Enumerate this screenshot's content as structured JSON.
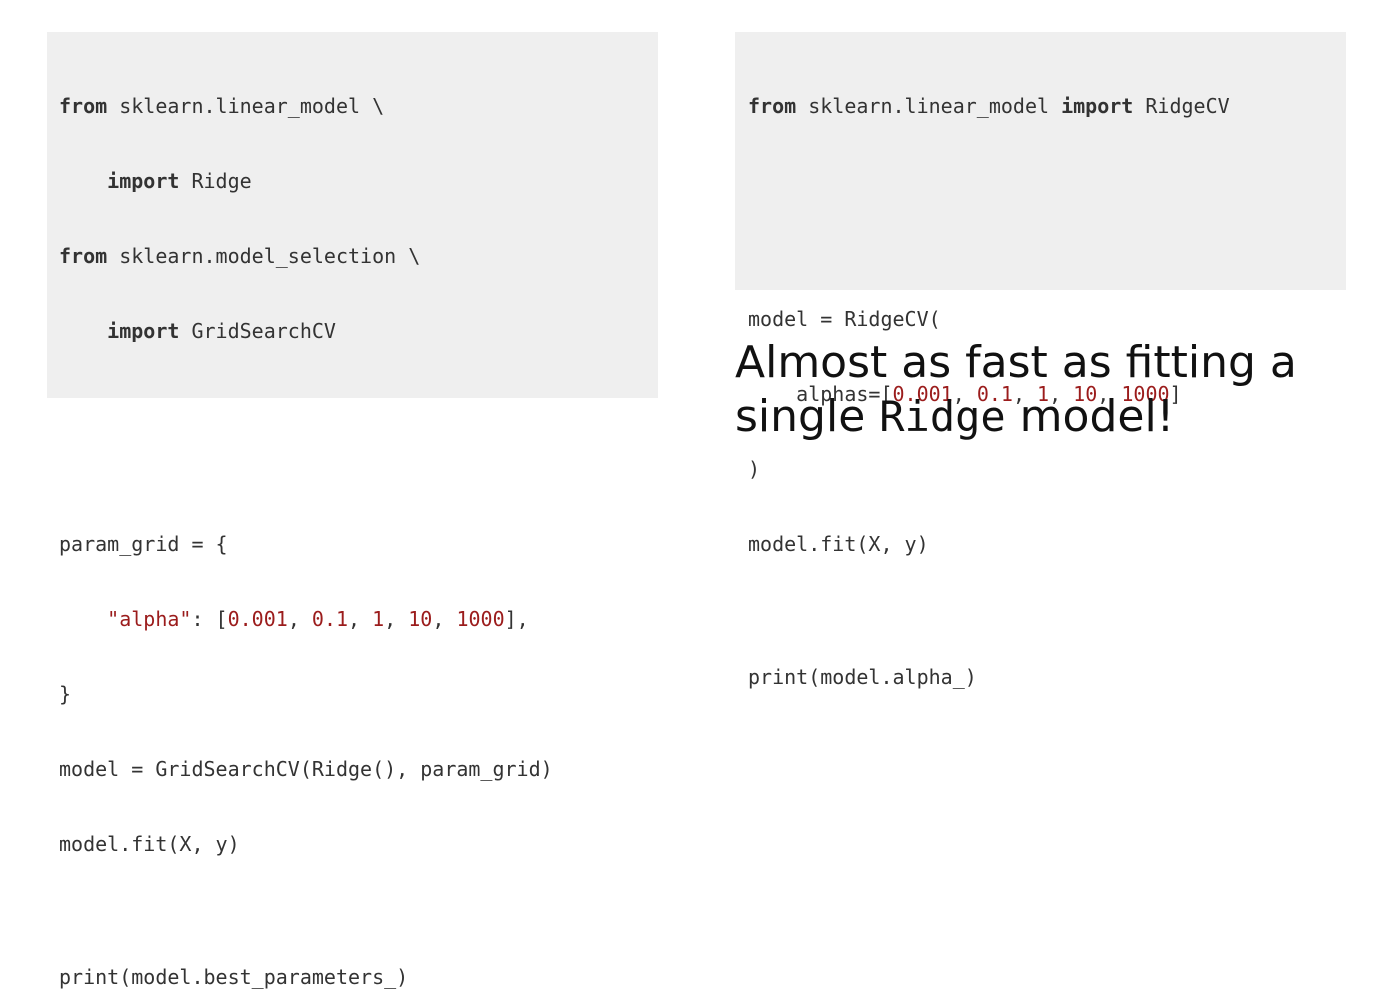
{
  "left_code": {
    "line1_kw": "from",
    "line1_rest": " sklearn.linear_model \\",
    "line2_indent": "    ",
    "line2_kw": "import",
    "line2_rest": " Ridge",
    "line3_kw": "from",
    "line3_rest": " sklearn.model_selection \\",
    "line4_indent": "    ",
    "line4_kw": "import",
    "line4_rest": " GridSearchCV",
    "line5": "param_grid = {",
    "line6_indent": "    ",
    "line6_str": "\"alpha\"",
    "line6_a": ": [",
    "line6_n1": "0.001",
    "line6_s1": ", ",
    "line6_n2": "0.1",
    "line6_s2": ", ",
    "line6_n3": "1",
    "line6_s3": ", ",
    "line6_n4": "10",
    "line6_s4": ", ",
    "line6_n5": "1000",
    "line6_end": "],",
    "line7": "}",
    "line8": "model = GridSearchCV(Ridge(), param_grid)",
    "line9": "model.fit(X, y)",
    "line10": "print(model.best_parameters_)"
  },
  "right_code": {
    "line1_kw": "from",
    "line1_mid": " sklearn.linear_model ",
    "line1_kw2": "import",
    "line1_rest": " RidgeCV",
    "line2": "model = RidgeCV(",
    "line3_a": "    alphas=[",
    "line3_n1": "0.001",
    "line3_s1": ", ",
    "line3_n2": "0.1",
    "line3_s2": ", ",
    "line3_n3": "1",
    "line3_s3": ", ",
    "line3_n4": "10",
    "line3_s4": ", ",
    "line3_n5": "1000",
    "line3_end": "]",
    "line4": ")",
    "line5": "model.fit(X, y)",
    "line6": "print(model.alpha_)"
  },
  "caption": {
    "line1": "Almost as fast as fitting a",
    "line2_pre": "single ",
    "line2_code": "Ridge",
    "line2_post": " model!"
  },
  "colors": {
    "code_background": "#efefef",
    "keyword": "#333333",
    "number": "#9b1c1c",
    "string": "#9b1c1c"
  }
}
